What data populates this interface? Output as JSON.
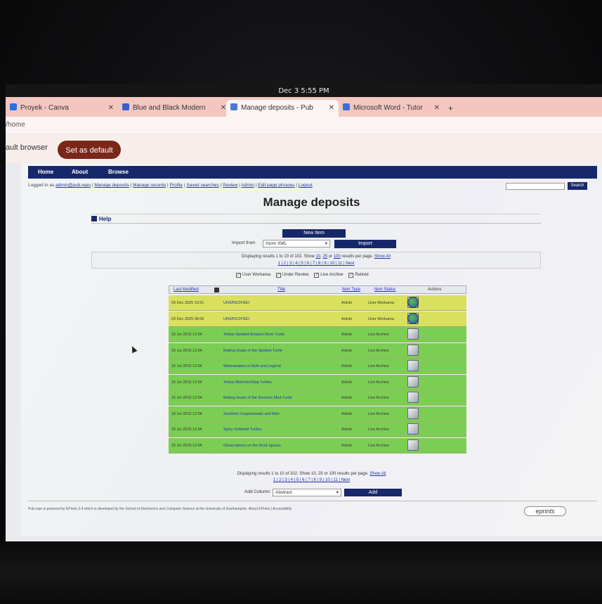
{
  "clock": "Dec 3   5:55 PM",
  "tabs": [
    {
      "label": "Proyek - Canva",
      "color": "#2f6fe0"
    },
    {
      "label": "Blue and Black Modern",
      "color": "#3a62c8"
    },
    {
      "label": "Manage deposits - Pub",
      "color": "#4a7bd6"
    },
    {
      "label": "Microsoft Word - Tutor",
      "color": "#3b6ed6"
    }
  ],
  "new_tab": "+",
  "url": "/home",
  "infobar": {
    "message": "ault browser",
    "set_default": "Set as default"
  },
  "nav": {
    "home": "Home",
    "about": "About",
    "browse": "Browse"
  },
  "userbar": {
    "logged_in": "Logged in as",
    "user": "admin@pub.repo",
    "links": [
      "Manage deposits",
      "Manage records",
      "Profile",
      "Saved searches",
      "Review",
      "Admin",
      "Edit page phrases",
      "Logout"
    ]
  },
  "search_button": "Search",
  "page_title": "Manage deposits",
  "help": "Help",
  "new_item": "New Item",
  "import": {
    "label": "Import from",
    "selected": "Atom XML",
    "button": "Import"
  },
  "pager_top": {
    "summary": "Displaying results 1 to 10 of 102. Show",
    "opt1": "10",
    "opt2": "25",
    "or": "or",
    "opt3": "100",
    "suffix": "results per page.",
    "show_all": "Show All",
    "pages": "1 | 2 | 3 | 4 | 5 | 6 | 7 | 8 | 9 | 10 | 11 | Next"
  },
  "filters": [
    "User Workarea",
    "Under Review",
    "Live Archive",
    "Retired"
  ],
  "columns": {
    "last_modified": "Last Modified",
    "title": "Title",
    "item_type": "Item Type",
    "item_status": "Item Status",
    "actions": "Actions"
  },
  "rows": [
    {
      "date": "03 Dec 2025 10:51",
      "title": "UNSPECIFIED",
      "type": "Article",
      "status": "User Workarea",
      "color": "y",
      "actions": [
        "view",
        "delete",
        "edit",
        "move"
      ]
    },
    {
      "date": "03 Dec 2025 08:00",
      "title": "UNSPECIFIED",
      "type": "Article",
      "status": "User Workarea",
      "color": "y",
      "actions": [
        "view",
        "delete",
        "edit",
        "move"
      ]
    },
    {
      "date": "15 Jul 2019 12:04",
      "title": "Yellow Spotted Amazon River Turtle",
      "type": "Article",
      "status": "Live Archive",
      "color": "g",
      "actions": [
        "view",
        "edit"
      ]
    },
    {
      "date": "15 Jul 2019 12:04",
      "title": "Mating rituals of the Spotted Turtle",
      "type": "Article",
      "status": "Live Archive",
      "color": "g",
      "actions": [
        "view",
        "edit"
      ]
    },
    {
      "date": "15 Jul 2019 12:04",
      "title": "Watersnakes in Myth and Legend",
      "type": "Article",
      "status": "Live Archive",
      "color": "g",
      "actions": [
        "view",
        "edit"
      ]
    },
    {
      "date": "15 Jul 2019 12:04",
      "title": "Yellow Blotched Map Turtles",
      "type": "Article",
      "status": "Live Archive",
      "color": "g",
      "actions": [
        "view",
        "edit"
      ]
    },
    {
      "date": "15 Jul 2019 12:04",
      "title": "Mating rituals of the Sonoran Mud Turtle",
      "type": "Article",
      "status": "Live Archive",
      "color": "g",
      "actions": [
        "view",
        "edit"
      ]
    },
    {
      "date": "15 Jul 2019 12:04",
      "title": "Southern Copperheads and Man",
      "type": "Article",
      "status": "Live Archive",
      "color": "g",
      "actions": [
        "view",
        "edit"
      ]
    },
    {
      "date": "15 Jul 2019 12:04",
      "title": "Spiny Softshell Turtles",
      "type": "Article",
      "status": "Live Archive",
      "color": "g",
      "actions": [
        "view",
        "edit"
      ]
    },
    {
      "date": "15 Jul 2019 12:04",
      "title": "Observations on the Rock Iguana",
      "type": "Article",
      "status": "Live Archive",
      "color": "g",
      "actions": [
        "view",
        "edit"
      ]
    }
  ],
  "pager_bottom": {
    "summary": "Displaying results 1 to 10 of 102. Show 10, 25 or 100 results per page.",
    "show_all": "Show All",
    "pages": "1 | 2 | 3 | 4 | 5 | 6 | 7 | 8 | 9 | 10 | 11 | Next"
  },
  "add_column": {
    "label": "Add Column:",
    "selected": "Abstract",
    "button": "Add"
  },
  "footer": "Pub.repo is powered by EPrints 3.4 which is developed by the School of Electronics and Computer Science at the University of Southampton. About EPrints | Accessibility",
  "eprints_logo": "eprints"
}
